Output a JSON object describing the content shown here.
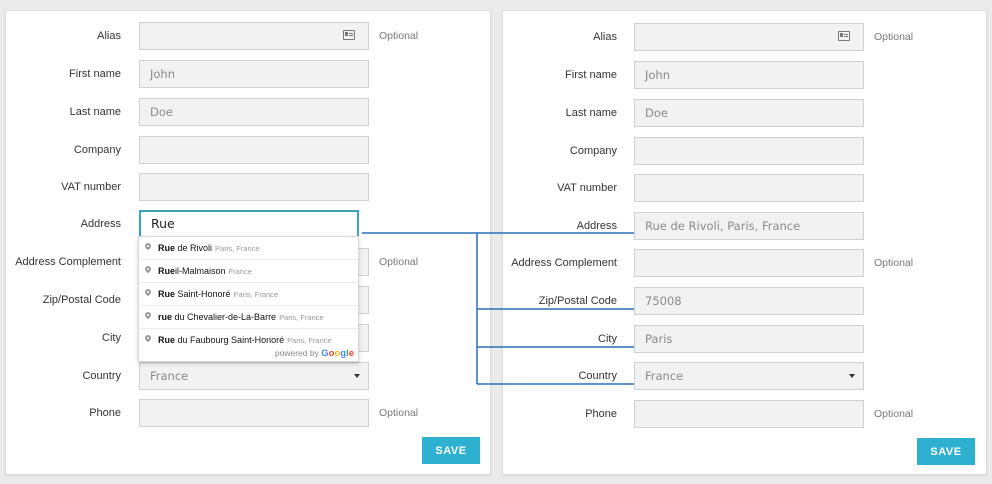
{
  "optional_label": "Optional",
  "save_label": "SAVE",
  "left_form": {
    "fields": [
      {
        "label": "Alias",
        "value": "",
        "optional": true
      },
      {
        "label": "First name",
        "value": "John"
      },
      {
        "label": "Last name",
        "value": "Doe"
      },
      {
        "label": "Company",
        "value": ""
      },
      {
        "label": "VAT number",
        "value": ""
      },
      {
        "label": "Address",
        "value": "Rue"
      },
      {
        "label": "Address Complement",
        "value": "",
        "optional": true
      },
      {
        "label": "Zip/Postal Code",
        "value": ""
      },
      {
        "label": "City",
        "value": ""
      },
      {
        "label": "Country",
        "value": "France"
      },
      {
        "label": "Phone",
        "value": "",
        "optional": true
      }
    ]
  },
  "autocomplete": {
    "suggestions": [
      {
        "match": "Rue",
        "rest": " de Rivoli",
        "secondary": "Paris, France"
      },
      {
        "match": "Rue",
        "rest": "il-Malmaison",
        "secondary": "France"
      },
      {
        "match": "Rue",
        "rest": " Saint-Honoré",
        "secondary": "Paris, France"
      },
      {
        "match": "rue",
        "rest": " du Chevalier-de-La-Barre",
        "secondary": "Paris, France"
      },
      {
        "match": "Rue",
        "rest": " du Faubourg Saint-Honoré",
        "secondary": "Paris, France"
      }
    ],
    "powered_by": "powered by",
    "provider": "Google"
  },
  "right_form": {
    "fields": [
      {
        "label": "Alias",
        "value": "",
        "optional": true
      },
      {
        "label": "First name",
        "value": "John"
      },
      {
        "label": "Last name",
        "value": "Doe"
      },
      {
        "label": "Company",
        "value": ""
      },
      {
        "label": "VAT number",
        "value": ""
      },
      {
        "label": "Address",
        "value": "Rue de Rivoli, Paris, France"
      },
      {
        "label": "Address Complement",
        "value": "",
        "optional": true
      },
      {
        "label": "Zip/Postal Code",
        "value": "75008"
      },
      {
        "label": "City",
        "value": "Paris"
      },
      {
        "label": "Country",
        "value": "France"
      },
      {
        "label": "Phone",
        "value": "",
        "optional": true
      }
    ]
  },
  "colors": {
    "accent": "#2eb0d0",
    "connector": "#2a6fb5",
    "active_border": "#3aa3be"
  }
}
